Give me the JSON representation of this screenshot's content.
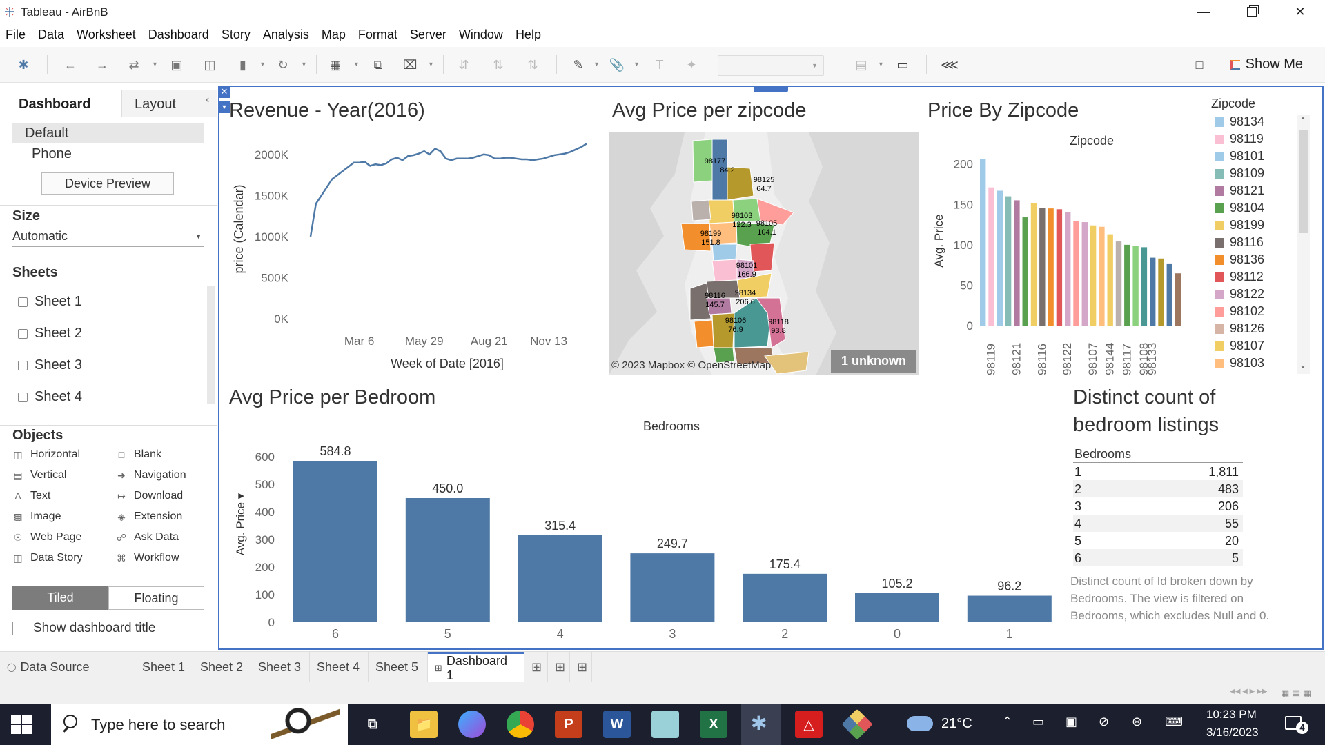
{
  "window": {
    "title": "Tableau - AirBnB"
  },
  "menu": [
    "File",
    "Data",
    "Worksheet",
    "Dashboard",
    "Story",
    "Analysis",
    "Map",
    "Format",
    "Server",
    "Window",
    "Help"
  ],
  "toolbar": {
    "show_me": "Show Me"
  },
  "left_pane": {
    "tabs": [
      "Dashboard",
      "Layout"
    ],
    "devices": [
      "Default",
      "Phone"
    ],
    "device_preview": "Device Preview",
    "size_label": "Size",
    "size_value": "Automatic",
    "sheets_label": "Sheets",
    "sheets": [
      "Sheet 1",
      "Sheet 2",
      "Sheet 3",
      "Sheet 4"
    ],
    "objects_label": "Objects",
    "objects": [
      {
        "label": "Horizontal",
        "icon": "horizontal-icon"
      },
      {
        "label": "Blank",
        "icon": "blank-icon"
      },
      {
        "label": "Vertical",
        "icon": "vertical-icon"
      },
      {
        "label": "Navigation",
        "icon": "navigation-icon"
      },
      {
        "label": "Text",
        "icon": "text-icon"
      },
      {
        "label": "Download",
        "icon": "download-icon"
      },
      {
        "label": "Image",
        "icon": "image-icon"
      },
      {
        "label": "Extension",
        "icon": "extension-icon"
      },
      {
        "label": "Web Page",
        "icon": "web-page-icon"
      },
      {
        "label": "Ask Data",
        "icon": "ask-data-icon"
      },
      {
        "label": "Data Story",
        "icon": "data-story-icon"
      },
      {
        "label": "Workflow",
        "icon": "workflow-icon"
      }
    ],
    "layout_modes": [
      "Tiled",
      "Floating"
    ],
    "show_title": "Show dashboard title"
  },
  "views": {
    "revenue_title": "Revenue - Year(2016)",
    "map_title": "Avg Price per zipcode",
    "zip_title": "Price By Zipcode",
    "bedroom_title": "Avg Price per Bedroom",
    "distinct_title_1": "Distinct count of",
    "distinct_title_2": "bedroom listings",
    "map_attribution": "© 2023 Mapbox © OpenStreetMap",
    "map_unknown": "1 unknown",
    "map_labels": [
      {
        "zip": "98177",
        "val": "84.2"
      },
      {
        "zip": "98125",
        "val": "64.7"
      },
      {
        "zip": "98103",
        "val": "122.3"
      },
      {
        "zip": "98105",
        "val": "104.1"
      },
      {
        "zip": "98199",
        "val": "151.8"
      },
      {
        "zip": "98101",
        "val": "166.9"
      },
      {
        "zip": "98116",
        "val": "145.7"
      },
      {
        "zip": "98134",
        "val": "206.6"
      },
      {
        "zip": "98106",
        "val": "76.9"
      },
      {
        "zip": "98118",
        "val": "93.8"
      }
    ],
    "table_header": "Bedrooms",
    "table_rows": [
      {
        "k": "1",
        "v": "1,811"
      },
      {
        "k": "2",
        "v": "483"
      },
      {
        "k": "3",
        "v": "206"
      },
      {
        "k": "4",
        "v": "55"
      },
      {
        "k": "5",
        "v": "20"
      },
      {
        "k": "6",
        "v": "5"
      }
    ],
    "caption": [
      "Distinct count of Id broken down by",
      "Bedrooms. The view is filtered on",
      "Bedrooms, which excludes Null and 0."
    ]
  },
  "chart_data": [
    {
      "type": "line",
      "title": "Revenue - Year(2016)",
      "xlabel": "Week of Date [2016]",
      "ylabel": "price (Calendar)",
      "y_ticks": [
        "2000K",
        "1500K",
        "1000K",
        "500K",
        "0K"
      ],
      "x_ticks": [
        "Mar 6",
        "May 29",
        "Aug 21",
        "Nov 13"
      ],
      "ylim": [
        0,
        2200000
      ],
      "x": [
        1,
        2,
        3,
        4,
        5,
        6,
        7,
        8,
        9,
        10,
        11,
        12,
        13,
        14,
        15,
        16,
        17,
        18,
        19,
        20,
        21,
        22,
        23,
        24,
        25,
        26,
        27,
        28,
        29,
        30,
        31,
        32,
        33,
        34,
        35,
        36,
        37,
        38,
        39,
        40,
        41,
        42,
        43,
        44,
        45,
        46,
        47,
        48,
        49,
        50,
        51,
        52
      ],
      "values": [
        1000000,
        1400000,
        1500000,
        1600000,
        1700000,
        1750000,
        1800000,
        1850000,
        1900000,
        1900000,
        1910000,
        1860000,
        1880000,
        1870000,
        1890000,
        1940000,
        1960000,
        1930000,
        1980000,
        1990000,
        2010000,
        2040000,
        2000000,
        2070000,
        2040000,
        1950000,
        1930000,
        1950000,
        1950000,
        1950000,
        1960000,
        1980000,
        2000000,
        1990000,
        1950000,
        1950000,
        1960000,
        1960000,
        1950000,
        1940000,
        1940000,
        1930000,
        1940000,
        1950000,
        1970000,
        1990000,
        2000000,
        2010000,
        2030000,
        2060000,
        2090000,
        2130000
      ],
      "series_color": "#4e79a7"
    },
    {
      "type": "bar",
      "title": "Price By Zipcode",
      "xlabel": "Zipcode",
      "ylabel": "Avg. Price",
      "ylim": [
        0,
        210
      ],
      "y_ticks": [
        0,
        50,
        100,
        150,
        200
      ],
      "categories": [
        "98134",
        "98119",
        "98101",
        "98109",
        "98121",
        "98104",
        "98199",
        "98116",
        "98136",
        "98112",
        "98122",
        "98102",
        "98126",
        "98107",
        "98103",
        "98144",
        "98105",
        "98117",
        "98115",
        "98108",
        "98133",
        "98106",
        "98125",
        "98118"
      ],
      "x_tick_labels": [
        "98119",
        "98121",
        "98116",
        "98122",
        "98107",
        "98144",
        "98117",
        "98108",
        "98133"
      ],
      "values": [
        206.6,
        171,
        166.9,
        160,
        155,
        134,
        151.8,
        145.7,
        145,
        144,
        140,
        129,
        128,
        124,
        122.3,
        113,
        104.1,
        100,
        99,
        97,
        84,
        83,
        76.9,
        64.7
      ],
      "colors": [
        "#a0cbe8",
        "#fabfd2",
        "#a0cbe8",
        "#86bcb6",
        "#b07aa1",
        "#59a14f",
        "#f1ce63",
        "#79706e",
        "#f28e2b",
        "#e15759",
        "#d4a6c8",
        "#ff9d9a",
        "#d4a6c8",
        "#f1ce63",
        "#ffbe7d",
        "#f1ce63",
        "#bab0ac",
        "#59a14f",
        "#8cd17d",
        "#499894",
        "#4e79a7",
        "#b6992d",
        "#4e79a7",
        "#9d7660"
      ]
    },
    {
      "type": "bar",
      "title": "Avg Price per Bedroom",
      "xlabel": "Bedrooms",
      "ylabel": "Avg. Price",
      "ylim": [
        0,
        640
      ],
      "y_ticks": [
        0,
        100,
        200,
        300,
        400,
        500,
        600
      ],
      "categories": [
        "6",
        "5",
        "4",
        "3",
        "2",
        "0",
        "1"
      ],
      "values": [
        584.8,
        450.0,
        315.4,
        249.7,
        175.4,
        105.2,
        96.2
      ],
      "value_labels": [
        "584.8",
        "450.0",
        "315.4",
        "249.7",
        "175.4",
        "105.2",
        "96.2"
      ],
      "series_color": "#4e79a7"
    }
  ],
  "zip_legend": {
    "title": "Zipcode",
    "items": [
      {
        "label": "98134",
        "color": "#a0cbe8"
      },
      {
        "label": "98119",
        "color": "#fabfd2"
      },
      {
        "label": "98101",
        "color": "#a0cbe8"
      },
      {
        "label": "98109",
        "color": "#86bcb6"
      },
      {
        "label": "98121",
        "color": "#b07aa1"
      },
      {
        "label": "98104",
        "color": "#59a14f"
      },
      {
        "label": "98199",
        "color": "#f1ce63"
      },
      {
        "label": "98116",
        "color": "#79706e"
      },
      {
        "label": "98136",
        "color": "#f28e2b"
      },
      {
        "label": "98112",
        "color": "#e15759"
      },
      {
        "label": "98122",
        "color": "#d4a6c8"
      },
      {
        "label": "98102",
        "color": "#ff9d9a"
      },
      {
        "label": "98126",
        "color": "#d7b5a6"
      },
      {
        "label": "98107",
        "color": "#f1ce63"
      },
      {
        "label": "98103",
        "color": "#ffbe7d"
      }
    ]
  },
  "sheet_tabs": [
    "Data Source",
    "Sheet 1",
    "Sheet 2",
    "Sheet 3",
    "Sheet 4",
    "Sheet 5",
    "Dashboard 1"
  ],
  "taskbar": {
    "search_placeholder": "Type here to search",
    "weather": "21°C",
    "time": "10:23 PM",
    "date": "3/16/2023",
    "notif_count": "4"
  }
}
